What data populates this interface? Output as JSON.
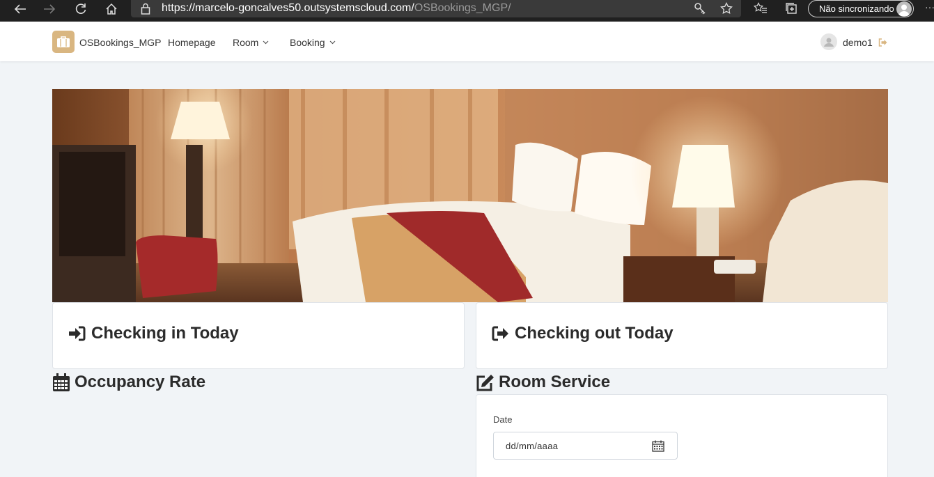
{
  "browser": {
    "url_main": "https://marcelo-goncalves50.outsystemscloud.com/",
    "url_path": "OSBookings_MGP/",
    "sync_label": "Não sincronizando"
  },
  "header": {
    "app_name": "OSBookings_MGP",
    "menu": [
      {
        "label": "Homepage"
      },
      {
        "label": "Room"
      },
      {
        "label": "Booking"
      }
    ],
    "user_name": "demo1"
  },
  "cards": {
    "checkin_title": "Checking in Today",
    "checkout_title": "Checking out Today"
  },
  "sections": {
    "occupancy_title": "Occupancy Rate",
    "room_service_title": "Room Service"
  },
  "room_service": {
    "date_label": "Date",
    "date_placeholder": "dd/mm/aaaa"
  },
  "colors": {
    "accent": "#d9b681",
    "background": "#f1f4f7",
    "browser_bar": "#202020"
  },
  "icons": {
    "checkin": "sign-in-icon",
    "checkout": "sign-out-icon",
    "occupancy": "calendar-icon",
    "room_service": "edit-icon"
  }
}
